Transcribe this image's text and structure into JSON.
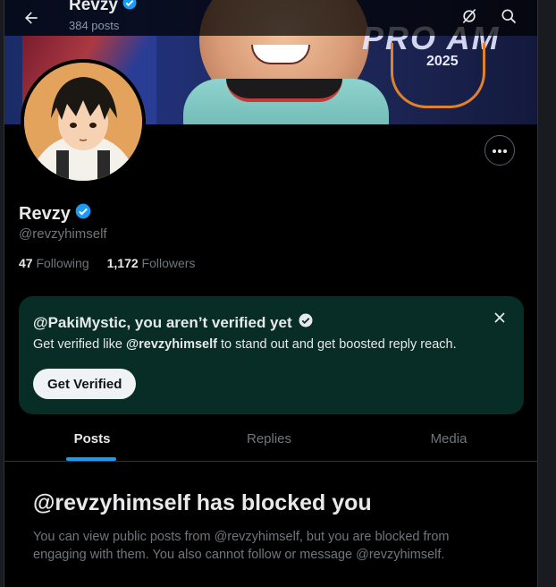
{
  "header": {
    "name": "Revzy",
    "posts_count": "384 posts"
  },
  "profile": {
    "name": "Revzy",
    "handle": "@revzyhimself",
    "following_count": "47",
    "following_label": "Following",
    "followers_count": "1,172",
    "followers_label": "Followers"
  },
  "promo": {
    "title": "@PakiMystic, you aren’t verified yet",
    "body_prefix": "Get verified like ",
    "body_handle": "@revzyhimself",
    "body_suffix": " to stand out and get boosted reply reach.",
    "cta_label": "Get Verified"
  },
  "tabs": [
    {
      "label": "Posts",
      "active": true
    },
    {
      "label": "Replies",
      "active": false
    },
    {
      "label": "Media",
      "active": false
    }
  ],
  "blocked": {
    "title": "@revzyhimself has blocked you",
    "description": "You can view public posts from @revzyhimself, but you are blocked from engaging with them. You also cannot follow or message @revzyhimself."
  },
  "banner": {
    "logo_text": "PRO AM",
    "badge_text": "2025"
  },
  "icons": {
    "back": "arrow-left-icon",
    "grok": "grok-icon",
    "search": "search-icon",
    "more": "ellipsis-icon",
    "verified": "verified-badge-icon",
    "close": "close-icon"
  },
  "colors": {
    "accent": "#1d9bf0",
    "promo_bg": "#072d26",
    "text_secondary": "#71767b"
  }
}
